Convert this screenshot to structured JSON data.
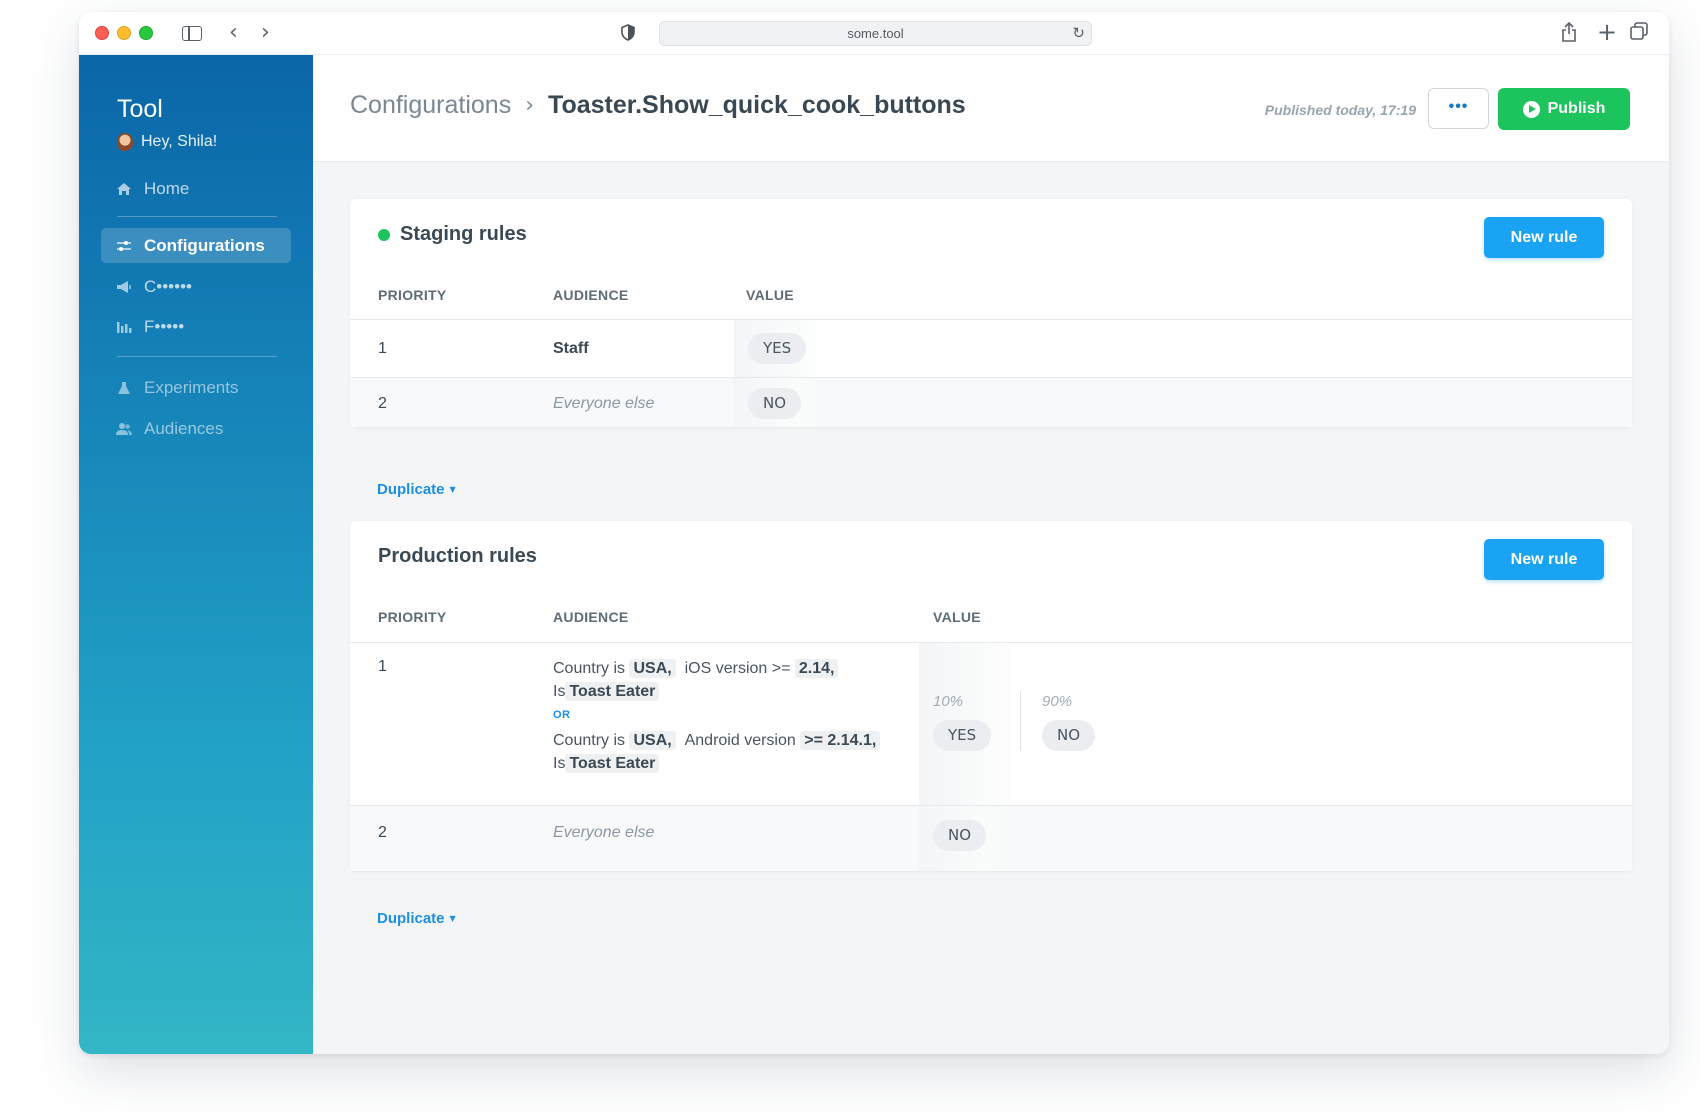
{
  "browser": {
    "url": "some.tool"
  },
  "sidebar": {
    "brand": "Tool",
    "greeting": "Hey, Shila!",
    "items": [
      {
        "label": "Home",
        "icon": "home-icon"
      },
      {
        "label": "Configurations",
        "icon": "sliders-icon",
        "active": true
      },
      {
        "label": "C••••••",
        "icon": "megaphone-icon"
      },
      {
        "label": "F•••••",
        "icon": "chart-icon"
      },
      {
        "label": "Experiments",
        "icon": "flask-icon"
      },
      {
        "label": "Audiences",
        "icon": "users-icon"
      }
    ]
  },
  "header": {
    "breadcrumb_parent": "Configurations",
    "breadcrumb_separator": "›",
    "title": "Toaster.Show_quick_cook_buttons",
    "published": "Published today, 17:19",
    "more_label": "•••",
    "publish_label": "Publish"
  },
  "staging": {
    "title": "Staging rules",
    "new_rule_label": "New rule",
    "columns": {
      "priority": "PRIORITY",
      "audience": "AUDIENCE",
      "value": "VALUE"
    },
    "rows": [
      {
        "priority": "1",
        "audience": "Staff",
        "value": "YES"
      },
      {
        "priority": "2",
        "audience": "Everyone else",
        "value": "NO"
      }
    ],
    "duplicate_label": "Duplicate"
  },
  "production": {
    "title": "Production rules",
    "new_rule_label": "New rule",
    "columns": {
      "priority": "PRIORITY",
      "audience": "AUDIENCE",
      "value": "VALUE"
    },
    "rows": [
      {
        "priority": "1",
        "conditions": [
          {
            "country_prefix": "Country is",
            "country": "USA,",
            "platform_prefix": "iOS version >=",
            "version": "2.14,",
            "is_prefix": "Is",
            "segment": "Toast Eater"
          },
          {
            "country_prefix": "Country is",
            "country": "USA,",
            "platform_prefix": "Android version",
            "version": ">= 2.14.1,",
            "is_prefix": "Is",
            "segment": "Toast Eater"
          }
        ],
        "or_label": "OR",
        "split": [
          {
            "percent": "10%",
            "value": "YES"
          },
          {
            "percent": "90%",
            "value": "NO"
          }
        ]
      },
      {
        "priority": "2",
        "audience": "Everyone else",
        "value": "NO"
      }
    ],
    "duplicate_label": "Duplicate"
  },
  "colors": {
    "sidebar_top": "#0b66a8",
    "sidebar_bottom": "#33b6c5",
    "publish_green": "#1dc45d",
    "button_blue": "#1aa3f2",
    "link_blue": "#1d8fe0"
  }
}
